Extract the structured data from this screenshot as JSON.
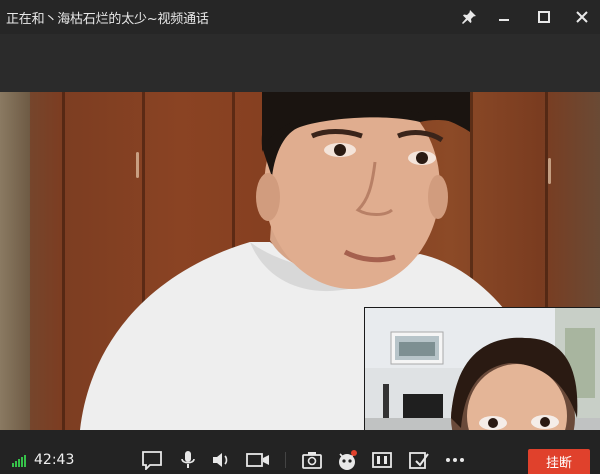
{
  "window": {
    "title": "正在和丶海枯石烂的太少~视频通话"
  },
  "call": {
    "duration": "42:43",
    "hangup_label": "挂断"
  },
  "colors": {
    "hangup": "#e0412c",
    "signal": "#36c24a",
    "titlebar": "#262626",
    "toolbar": "#232323"
  },
  "toolbar": {
    "icons": [
      "message-icon",
      "microphone-icon",
      "speaker-icon",
      "camera-icon",
      "screenshot-icon",
      "effects-icon",
      "layout-icon",
      "whiteboard-icon",
      "more-icon"
    ]
  }
}
